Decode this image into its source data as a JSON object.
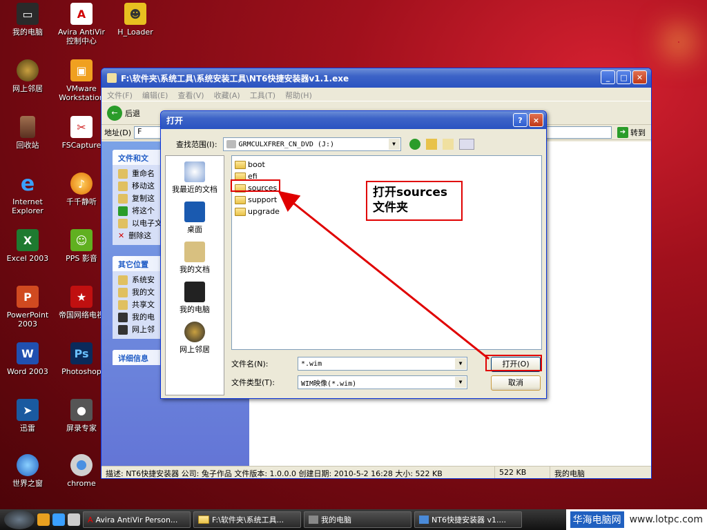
{
  "desktop": {
    "icons": [
      {
        "label": "我的电脑"
      },
      {
        "label": "Avira AntiVir 控制中心"
      },
      {
        "label": "H_Loader"
      },
      {
        "label": "网上邻居"
      },
      {
        "label": "VMware Workstation"
      },
      {
        "label": "回收站"
      },
      {
        "label": "FSCapture"
      },
      {
        "label": "Internet Explorer"
      },
      {
        "label": "千千静听"
      },
      {
        "label": "Excel 2003"
      },
      {
        "label": "PPS 影音"
      },
      {
        "label": "PowerPoint 2003"
      },
      {
        "label": "帝国网络电视"
      },
      {
        "label": "Word 2003"
      },
      {
        "label": "Photoshop"
      },
      {
        "label": "迅雷"
      },
      {
        "label": "屏录专家"
      },
      {
        "label": "世界之窗"
      },
      {
        "label": "chrome"
      }
    ]
  },
  "explorer": {
    "title": "F:\\软件夹\\系统工具\\系统安装工具\\NT6快捷安装器v1.1.exe",
    "menu": [
      "文件(F)",
      "编辑(E)",
      "查看(V)",
      "收藏(A)",
      "工具(T)",
      "帮助(H)"
    ],
    "back_label": "后退",
    "address_label": "地址(D)",
    "address_value": "F",
    "go_label": "转到",
    "tasks_panel": {
      "title": "文件和文",
      "items": [
        "重命名",
        "移动这",
        "复制这",
        "将这个",
        "以电子文件",
        "删除这"
      ]
    },
    "places_panel": {
      "title": "其它位置",
      "items": [
        "系统安",
        "我的文",
        "共享文",
        "我的电",
        "网上邻"
      ]
    },
    "details_panel": {
      "title": "详细信息"
    },
    "status": {
      "description": "描述: NT6快捷安装器 公司: 兔子作品 文件版本: 1.0.0.0 创建日期: 2010-5-2 16:28 大小: 522 KB",
      "size": "522 KB",
      "location": "我的电脑"
    }
  },
  "dialog": {
    "title": "打开",
    "look_in_label": "查找范围(I):",
    "look_in_value": "GRMCULXFRER_CN_DVD (J:)",
    "places": [
      "我最近的文档",
      "桌面",
      "我的文档",
      "我的电脑",
      "网上邻居"
    ],
    "files": [
      "boot",
      "efi",
      "sources",
      "support",
      "upgrade"
    ],
    "filename_label": "文件名(N):",
    "filename_value": "*.wim",
    "filetype_label": "文件类型(T):",
    "filetype_value": "WIM映像(*.wim)",
    "open_button": "打开(O)",
    "cancel_button": "取消",
    "help_button": "?",
    "close_button": "×"
  },
  "annotation": {
    "callout_text_line1": "打开sources",
    "callout_text_line2": "文件夹",
    "color": "#e00000"
  },
  "taskbar": {
    "tasks": [
      "Avira AntiVir Person...",
      "F:\\软件夹\\系统工具...",
      "我的电脑",
      "NT6快捷安装器 v1...."
    ]
  },
  "watermark": {
    "site_name": "华海电脑网",
    "url": "www.lotpc.com"
  }
}
